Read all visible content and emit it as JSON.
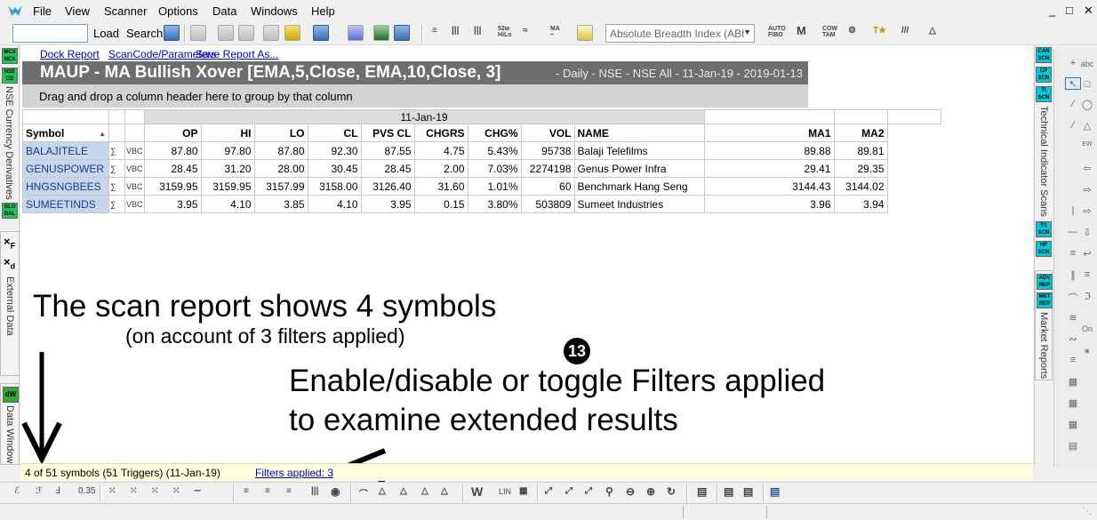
{
  "menu": {
    "items": [
      "File",
      "View",
      "Scanner",
      "Options",
      "Data",
      "Windows",
      "Help"
    ],
    "window_controls": [
      "_",
      "□",
      "✕"
    ]
  },
  "toolbar": {
    "symbol_input_value": "",
    "load_label": "Load",
    "search_label": "Search",
    "indicator_value": "Absolute Breadth Index (ABI"
  },
  "left_panel": {
    "badges": [
      "MCX NCX",
      "NSE CD",
      "GLO BAL"
    ],
    "currency_label": "NSE Currency Derivatives",
    "external_label": "External Data",
    "dw_badge": "dW",
    "data_window_label": "Data Window"
  },
  "right_panel": {
    "badges_top": [
      "CAN SCN",
      "CP SCN",
      "TI SCN"
    ],
    "tech_label": "Technical Indicator Scans",
    "badges_mid": [
      "TS SCN",
      "HP SCN"
    ],
    "badges_bottom": [
      "ADV REP",
      "MKT REP"
    ],
    "market_label": "Market Reports"
  },
  "report": {
    "dock_link": "Dock Report",
    "scancode_link": "ScanCode/Parameters",
    "save_link": "Save Report As...",
    "title": "MAUP - MA Bullish Xover [EMA,5,Close, EMA,10,Close, 3]",
    "subtitle": "- Daily - NSE - NSE All - 11-Jan-19 - 2019-01-13",
    "groupby_hint": "Drag and drop a column header here to group by that column",
    "date_header": "11-Jan-19",
    "columns": {
      "symbol": "Symbol",
      "sort": "▲",
      "op": "OP",
      "hi": "HI",
      "lo": "LO",
      "cl": "CL",
      "pvs": "PVS CL",
      "chgrs": "CHGRS",
      "chgp": "CHG%",
      "vol": "VOL",
      "name": "NAME",
      "ma1": "MA1",
      "ma2": "MA2"
    },
    "rows": [
      {
        "symbol": "BALAJITELE",
        "vbc": "VBC",
        "op": "87.80",
        "hi": "97.80",
        "lo": "87.80",
        "cl": "92.30",
        "pvs": "87.55",
        "chgrs": "4.75",
        "chgp": "5.43%",
        "vol": "95738",
        "name": "Balaji Telefilms",
        "ma1": "89.88",
        "ma2": "89.81"
      },
      {
        "symbol": "GENUSPOWER",
        "vbc": "VBC",
        "op": "28.45",
        "hi": "31.20",
        "lo": "28.00",
        "cl": "30.45",
        "pvs": "28.45",
        "chgrs": "2.00",
        "chgp": "7.03%",
        "vol": "2274198",
        "name": "Genus Power Infra",
        "ma1": "29.41",
        "ma2": "29.35"
      },
      {
        "symbol": "HNGSNGBEES",
        "vbc": "VBC",
        "op": "3159.95",
        "hi": "3159.95",
        "lo": "3157.99",
        "cl": "3158.00",
        "pvs": "3126.40",
        "chgrs": "31.60",
        "chgp": "1.01%",
        "vol": "60",
        "name": "Benchmark Hang Seng",
        "ma1": "3144.43",
        "ma2": "3144.02"
      },
      {
        "symbol": "SUMEETINDS",
        "vbc": "VBC",
        "op": "3.95",
        "hi": "4.10",
        "lo": "3.85",
        "cl": "4.10",
        "pvs": "3.95",
        "chgrs": "0.15",
        "chgp": "3.80%",
        "vol": "503809",
        "name": "Sumeet Industries",
        "ma1": "3.96",
        "ma2": "3.94"
      }
    ]
  },
  "annotations": {
    "line1": "The scan report shows 4 symbols",
    "line2": "(on account of 3 filters applied)",
    "step_number": "13",
    "line3": "Enable/disable or toggle Filters applied",
    "line4": "to examine extended results"
  },
  "status": {
    "count_text": "4 of 51 symbols (51 Triggers) (11-Jan-19)",
    "filters_link": "Filters applied: 3"
  },
  "bottom_toolbar": {
    "lin_label": "LIN"
  }
}
